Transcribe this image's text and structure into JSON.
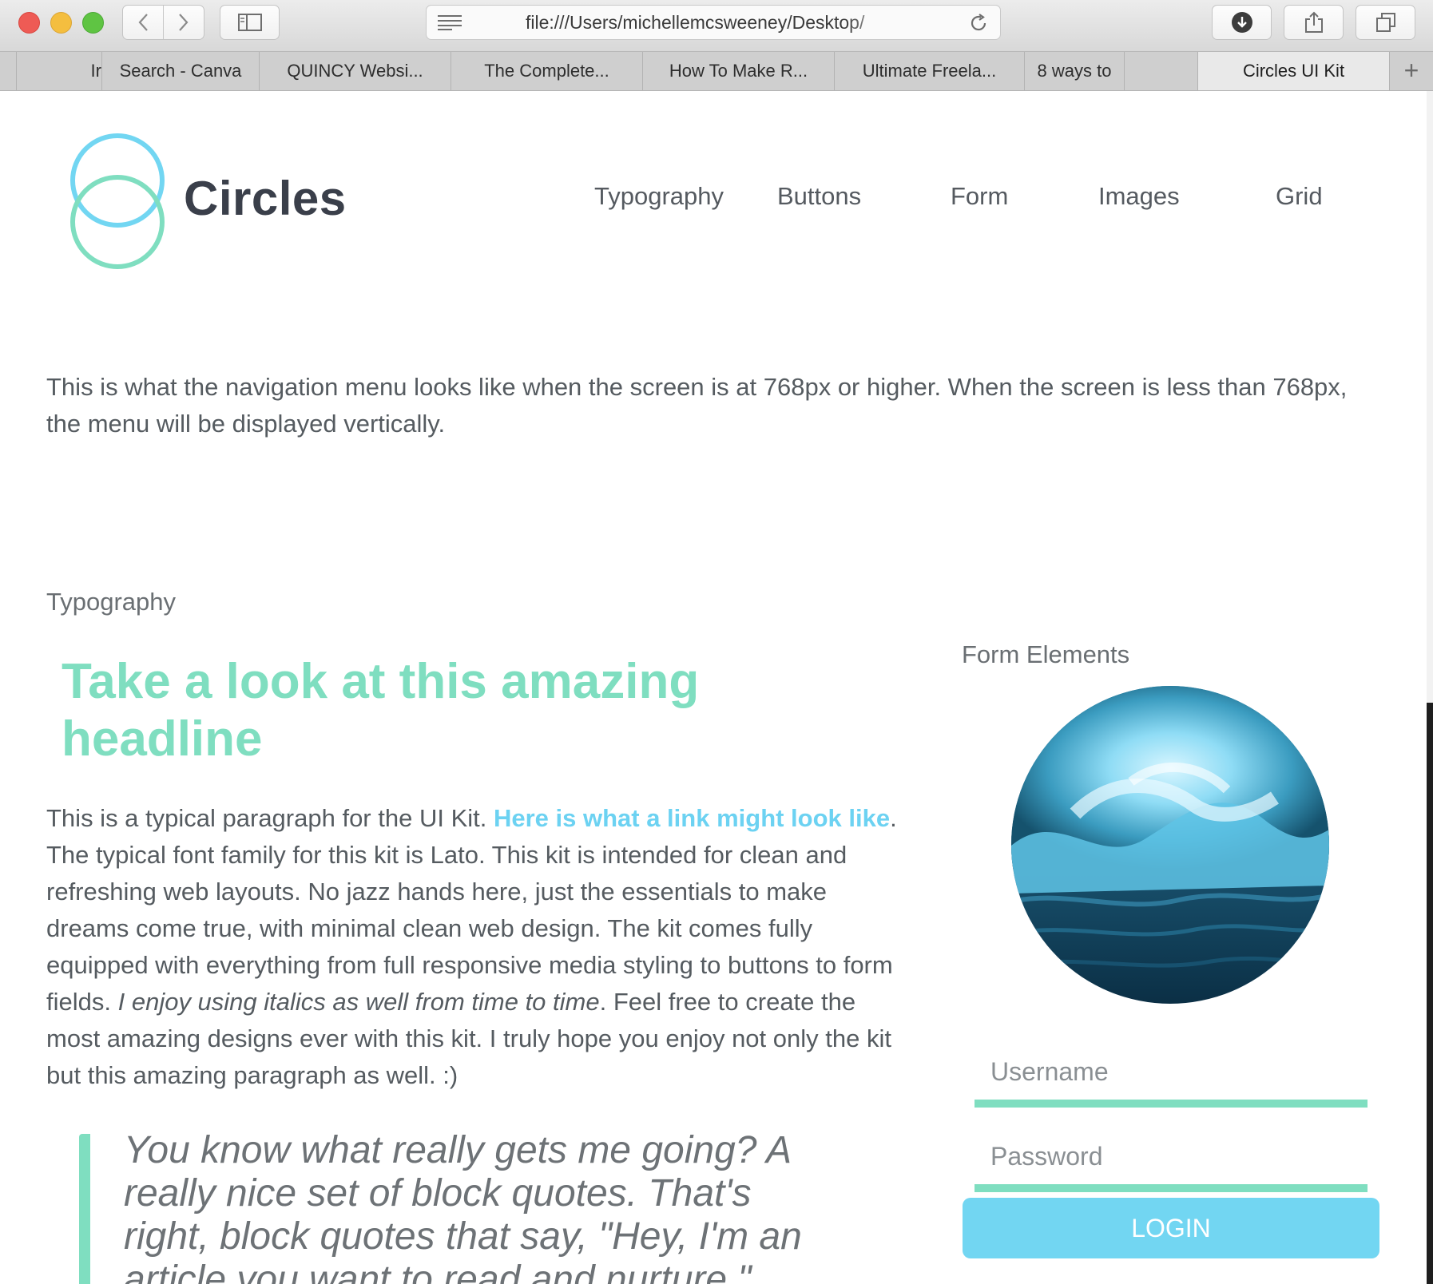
{
  "browser": {
    "url": "file:///Users/michellemcsweeney/Desktop/",
    "tabs": [
      {
        "label": "Ir"
      },
      {
        "label": "Search - Canva"
      },
      {
        "label": "QUINCY Websi..."
      },
      {
        "label": "The Complete..."
      },
      {
        "label": "How To Make R..."
      },
      {
        "label": "Ultimate Freela..."
      },
      {
        "label": "8 ways to"
      },
      {
        "label": ""
      },
      {
        "label": "Circles UI Kit",
        "active": true
      }
    ],
    "icons": [
      "back-icon",
      "forward-icon",
      "sidebar-icon",
      "reader-icon",
      "reload-icon",
      "download-icon",
      "share-icon",
      "tabs-overview-icon",
      "new-tab-icon"
    ]
  },
  "site": {
    "brand": "Circles",
    "nav": [
      "Typography",
      "Buttons",
      "Form",
      "Images",
      "Grid"
    ],
    "colors": {
      "mint": "#7fdec0",
      "sky": "#72d6f2",
      "text": "#555b60"
    }
  },
  "intro": "This is what the navigation menu looks like when the screen is at 768px or higher. When the screen is less than 768px, the menu will be displayed vertically.",
  "typography": {
    "label": "Typography",
    "headline": "Take a look at this amazing headline",
    "para_start": "This is a typical paragraph for the UI Kit. ",
    "link": "Here is what a link might look like",
    "para_mid": ". The typical font family for this kit is Lato. This kit is intended for clean and refreshing web layouts. No jazz hands here, just the essentials to make dreams come true, with minimal clean web design. The kit comes fully equipped with everything from full responsive media styling to buttons to form fields. ",
    "italic": "I enjoy using italics as well from time to time",
    "para_end": ". Feel free to create the most amazing designs ever with this kit. I truly hope you enjoy not only the kit but this amazing paragraph as well. :)",
    "quote": "You know what really gets me going? A really nice set of block quotes. That's right, block quotes that say, \"Hey, I'm an article you want to read and nurture.\""
  },
  "form": {
    "label": "Form Elements",
    "username_placeholder": "Username",
    "password_placeholder": "Password",
    "login_label": "LOGIN"
  }
}
